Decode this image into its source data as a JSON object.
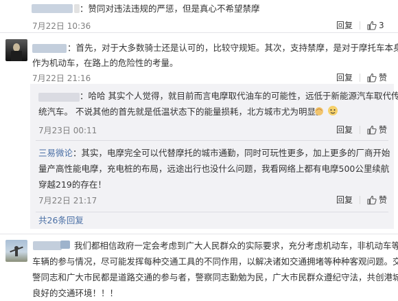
{
  "comments": [
    {
      "text": "：赞同对违法违规的严惩，但是真心不希望禁摩",
      "time": "7月22日 10:36",
      "reply_label": "回复",
      "likes": "3"
    },
    {
      "text_line1": "：首先，对于大多数骑士还是认可的，比较守规矩。其次，支持禁摩，是对于摩托车本身",
      "text_line2": "作为机动车，在路上的危险性的考量。",
      "time": "7月22日 21:16",
      "reply_label": "回复",
      "likes_label": "赞"
    }
  ],
  "replies": [
    {
      "text_line1": "：哈哈  其实个人觉得，就目前而言电摩取代油车的可能性，远低于新能源汽车取代传",
      "text_line2": "统汽车。  不说其他的首先就是低温状态下的能量损耗，北方城市尤为明显。",
      "time": "7月23日 00:11",
      "reply_label": "回复",
      "likes_label": "赞"
    },
    {
      "author": "三易微论",
      "text_line1": "：其实，电摩完全可以代替摩托的城市通勤，同时可玩性更多，加上更多的厂商开始",
      "text_line2": "量产高性能电摩，充电桩的布局，远途出行也没什么问题，我看网络上都有电摩500公里续航",
      "text_line3": "穿越219的存在！",
      "time": "7月22日 21:17",
      "reply_label": "回复",
      "likes_label": "赞"
    }
  ],
  "more_replies": "共26条回复",
  "last_comment": {
    "line1": "我们都相信政府一定会考虑到广大人民群众的实际要求，充分考虑机动车，非机动车等",
    "line2": "车辆的参与情况，尽可能发挥每种交通工具的不同作用，以解决诸如交通拥堵等种种客观问题。交",
    "line3": "警同志和广大市民都是道路交通的参与者，警察同志勤勉为民，广大市民群众遵纪守法，共创港城",
    "line4": "良好的交通环境！！！"
  },
  "colors": {
    "link": "#4a6fa5",
    "reply_bg": "#f2f2f5"
  }
}
